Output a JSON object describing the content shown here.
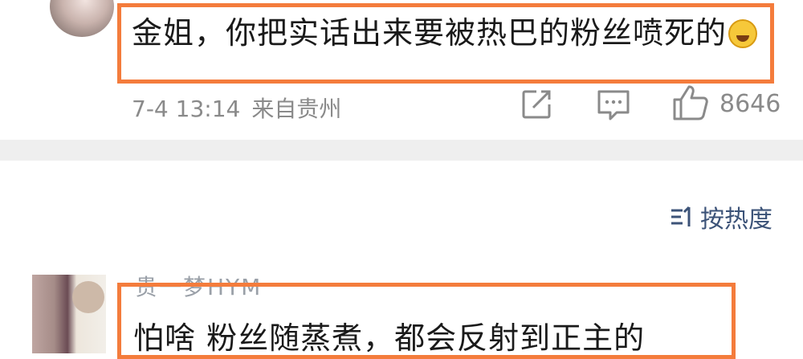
{
  "comment_top": {
    "text": "金姐，你把实话出来要被热巴的粉丝喷死的",
    "emoji": "laughing-crying-emoji",
    "date": "7-4 13:14",
    "location": "来自贵州",
    "likes": "8646"
  },
  "sort": {
    "label": "按热度",
    "icon": "sort-icon"
  },
  "comment_bottom": {
    "nickname": "贵一梦HYM",
    "text": "怕啥 粉丝随蒸煮，都会反射到正主的"
  },
  "colors": {
    "highlight": "#f47c3c",
    "sort_text": "#3c5378",
    "meta_text": "#8a8a8a",
    "divider": "#efefef"
  }
}
